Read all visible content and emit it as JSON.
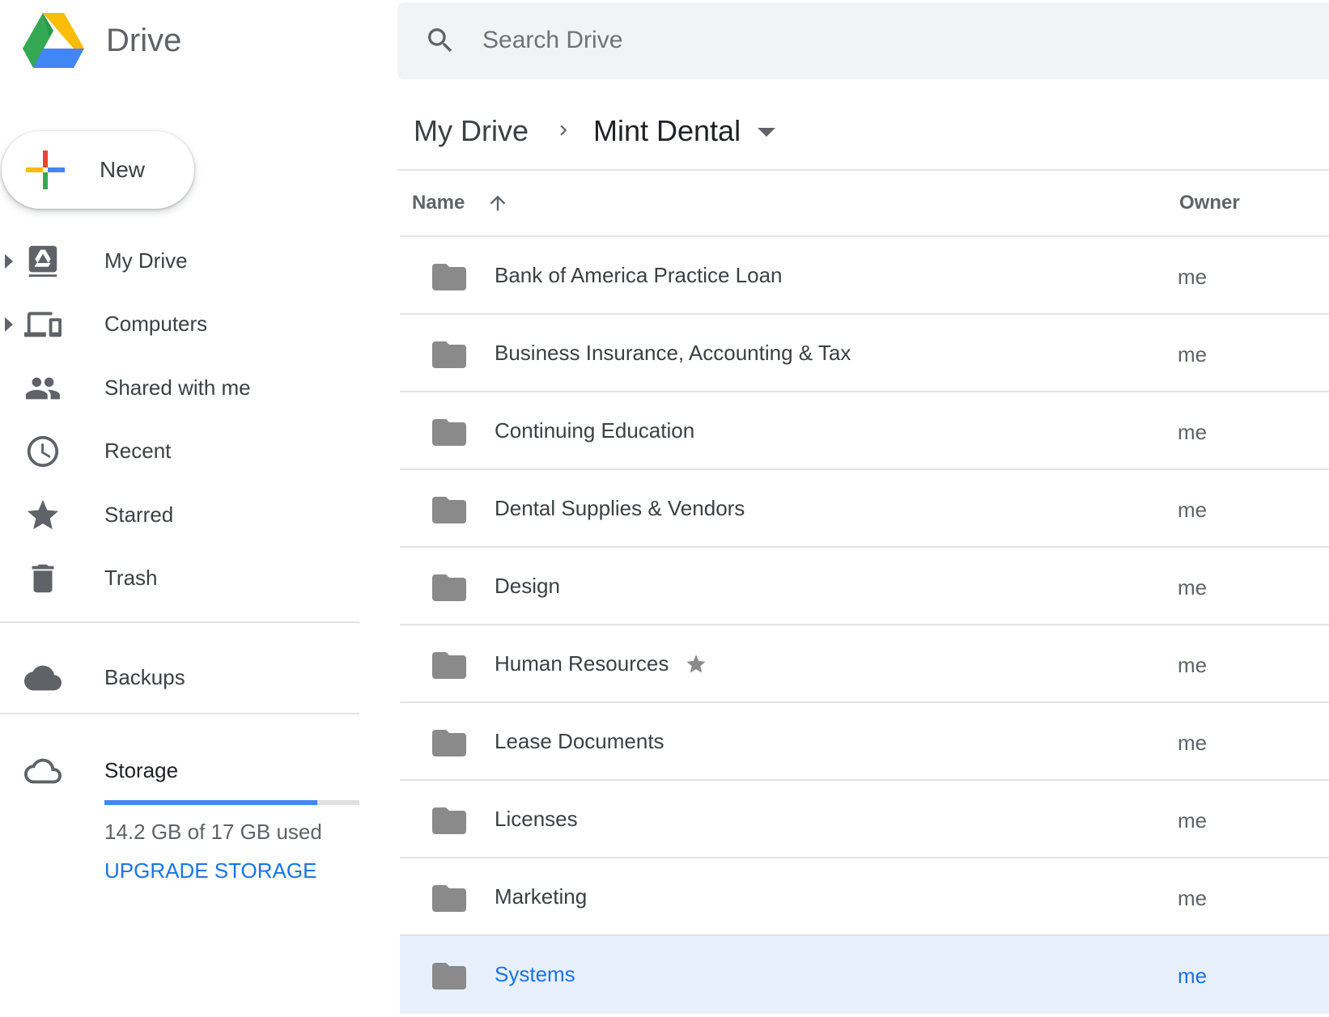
{
  "app": {
    "title": "Drive"
  },
  "search": {
    "placeholder": "Search Drive",
    "value": ""
  },
  "new_button": {
    "label": "New"
  },
  "sidebar": {
    "items": [
      {
        "label": "My Drive",
        "icon": "my-drive-icon",
        "expandable": true
      },
      {
        "label": "Computers",
        "icon": "computers-icon",
        "expandable": true
      },
      {
        "label": "Shared with me",
        "icon": "shared-icon",
        "expandable": false
      },
      {
        "label": "Recent",
        "icon": "clock-icon",
        "expandable": false
      },
      {
        "label": "Starred",
        "icon": "star-icon",
        "expandable": false
      },
      {
        "label": "Trash",
        "icon": "trash-icon",
        "expandable": false
      }
    ],
    "backups": {
      "label": "Backups",
      "icon": "cloud-icon"
    },
    "storage": {
      "label": "Storage",
      "icon": "cloud-outline-icon",
      "used_text": "14.2 GB of 17 GB used",
      "used_fraction": 0.835,
      "upgrade_label": "UPGRADE STORAGE"
    }
  },
  "breadcrumb": {
    "root": "My Drive",
    "current": "Mint Dental"
  },
  "list": {
    "columns": {
      "name": "Name",
      "owner": "Owner"
    },
    "sort": "ascending",
    "rows": [
      {
        "name": "Bank of America Practice Loan",
        "owner": "me",
        "starred": false,
        "selected": false
      },
      {
        "name": "Business Insurance, Accounting & Tax",
        "owner": "me",
        "starred": false,
        "selected": false
      },
      {
        "name": "Continuing Education",
        "owner": "me",
        "starred": false,
        "selected": false
      },
      {
        "name": "Dental Supplies & Vendors",
        "owner": "me",
        "starred": false,
        "selected": false
      },
      {
        "name": "Design",
        "owner": "me",
        "starred": false,
        "selected": false
      },
      {
        "name": "Human Resources",
        "owner": "me",
        "starred": true,
        "selected": false
      },
      {
        "name": "Lease Documents",
        "owner": "me",
        "starred": false,
        "selected": false
      },
      {
        "name": "Licenses",
        "owner": "me",
        "starred": false,
        "selected": false
      },
      {
        "name": "Marketing",
        "owner": "me",
        "starred": false,
        "selected": false
      },
      {
        "name": "Systems",
        "owner": "me",
        "starred": false,
        "selected": true
      }
    ]
  },
  "colors": {
    "accent": "#1a73e8",
    "selected_row": "#e8f0fe",
    "storage_fill": "#4285f4",
    "icon_gray": "#5f6368",
    "folder_gray": "#8a8a8a"
  }
}
